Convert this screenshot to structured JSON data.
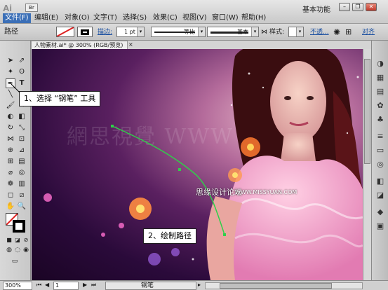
{
  "app": {
    "logo": "Ai",
    "bridge": "Br",
    "workspace": "基本功能"
  },
  "menu": [
    {
      "label": "文件(F)",
      "active": true
    },
    {
      "label": "编辑(E)"
    },
    {
      "label": "对象(O)"
    },
    {
      "label": "文字(T)"
    },
    {
      "label": "选择(S)"
    },
    {
      "label": "效果(C)"
    },
    {
      "label": "视图(V)"
    },
    {
      "label": "窗口(W)"
    },
    {
      "label": "帮助(H)"
    }
  ],
  "window_buttons": {
    "minimize": "–",
    "restore": "❐",
    "close": "✕"
  },
  "control": {
    "object_type": "路径",
    "stroke_label": "描边:",
    "stroke_weight": "1 pt",
    "profile": "等比",
    "brush": "基本",
    "style_label": "样式:",
    "opacity": "不透...",
    "align": "对齐"
  },
  "document": {
    "tab_title": "人物素材.ai* @ 300% (RGB/预览)",
    "close": "×"
  },
  "status": {
    "zoom": "300%",
    "page": "1",
    "tool": "钢笔"
  },
  "canvas": {
    "watermark_cn": "思缘设计论坛",
    "watermark_url": "WWW.MISSYUAN.COM",
    "big_watermark": "網思視覺 WWW"
  },
  "callouts": {
    "step1": "1、选择 “钢笔” 工具",
    "step2": "2、绘制路径"
  },
  "colors": {
    "accent": "#3b6fb7",
    "path": "#2fd04a",
    "canvas_bg": "#3a0f4a"
  }
}
